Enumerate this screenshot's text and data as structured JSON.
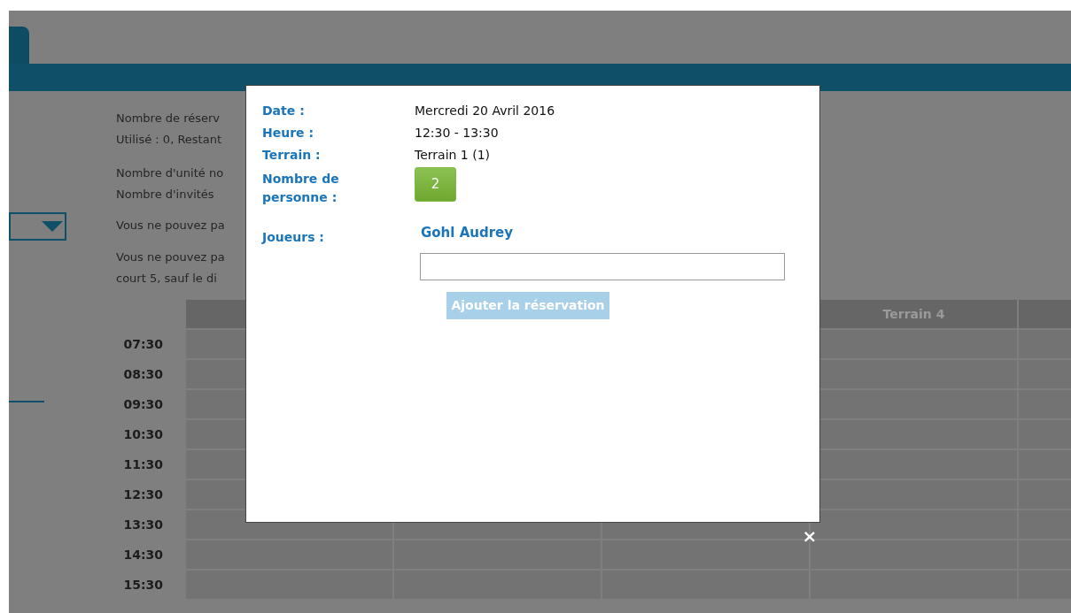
{
  "info_paragraphs": [
    [
      "Nombre de réserv",
      "Utilisé : 0, Restant"
    ],
    [
      "Nombre d'unité no",
      "Nombre d'invités"
    ],
    [
      "Vous ne pouvez pa"
    ],
    [
      "Vous ne pouvez pa",
      "court 5, sauf le di"
    ]
  ],
  "schedule": {
    "column_4_header": "Terrain 4",
    "times": [
      "07:30",
      "08:30",
      "09:30",
      "10:30",
      "11:30",
      "12:30",
      "13:30",
      "14:30",
      "15:30"
    ]
  },
  "dialog": {
    "fields": [
      {
        "kind": "text",
        "label": "Date :",
        "value": "Mercredi 20 Avril 2016"
      },
      {
        "kind": "text",
        "label": "Heure :",
        "value": "12:30 - 13:30"
      },
      {
        "kind": "text",
        "label": "Terrain :",
        "value": "Terrain 1 (1)"
      },
      {
        "kind": "count",
        "label": "Nombre de personne :",
        "value": "2"
      },
      {
        "kind": "players",
        "label": "Joueurs :",
        "value": "Gohl Audrey"
      }
    ],
    "add_button": {
      "label": "Ajouter la réservation",
      "disabled": true
    },
    "close": "×"
  }
}
